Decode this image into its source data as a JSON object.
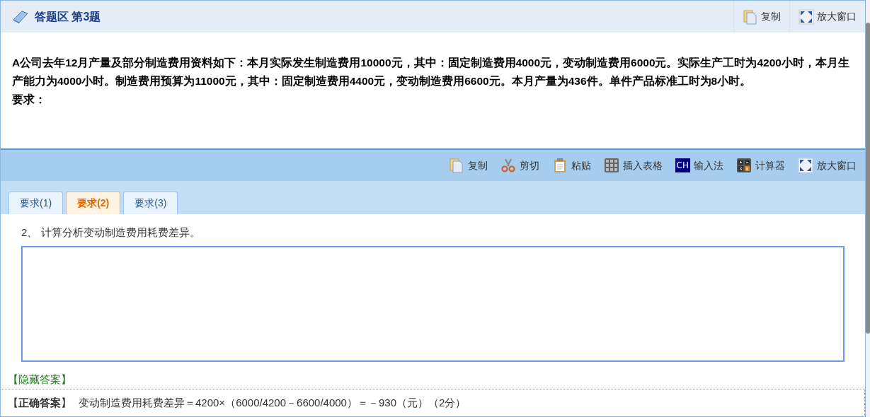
{
  "header": {
    "title": "答题区 第3题",
    "actions": [
      {
        "kind": "copy",
        "label": "复制"
      },
      {
        "kind": "maximize",
        "label": "放大窗口"
      }
    ]
  },
  "question": {
    "paragraph": "A公司去年12月产量及部分制造费用资料如下：本月实际发生制造费用10000元，其中：固定制造费用4000元，变动制造费用6000元。实际生产工时为4200小时，本月生产能力为4000小时。制造费用预算为11000元，其中：固定制造费用4400元，变动制造费用6600元。本月产量为436件。单件产品标准工时为8小时。",
    "requirement": "要求："
  },
  "toolbar": [
    {
      "kind": "copy",
      "label": "复制"
    },
    {
      "kind": "cut",
      "label": "剪切"
    },
    {
      "kind": "paste",
      "label": "粘贴"
    },
    {
      "kind": "table",
      "label": "插入表格"
    },
    {
      "kind": "ime",
      "label": "输入法",
      "icon_text": "CH"
    },
    {
      "kind": "calculator",
      "label": "计算器"
    },
    {
      "kind": "maximize",
      "label": "放大窗口"
    }
  ],
  "tabs": [
    {
      "label": "要求(1)",
      "selected": false
    },
    {
      "label": "要求(2)",
      "selected": true
    },
    {
      "label": "要求(3)",
      "selected": false
    }
  ],
  "prompt": "2、 计算分析变动制造费用耗费差异。",
  "hide_answer_link": "【隐藏答案】",
  "answer": {
    "label": "【**正确答案**】",
    "text": "变动制造费用耗费差异＝4200×（6000/4200－6600/4000）＝－930（元）（2分）"
  }
}
